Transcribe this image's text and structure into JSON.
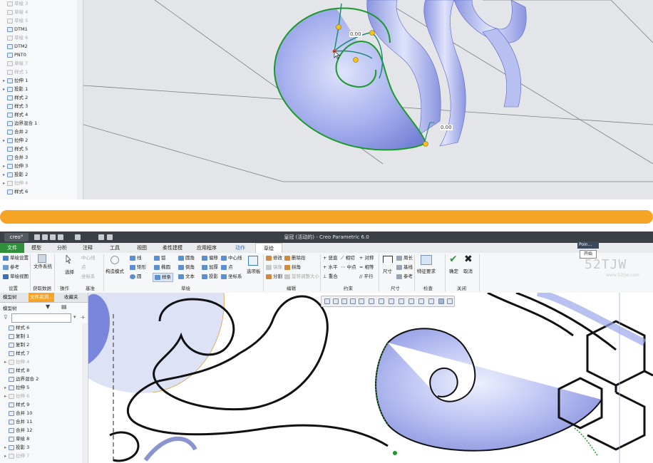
{
  "top_tree": {
    "rows": [
      {
        "label": "草绘 3",
        "icon": "sketch-icon",
        "dim": true
      },
      {
        "label": "草绘 4",
        "icon": "sketch-icon",
        "dim": true
      },
      {
        "label": "草绘 5",
        "icon": "sketch-icon",
        "dim": true
      },
      {
        "label": "DTM1",
        "icon": "datum-plane-icon",
        "dim": false
      },
      {
        "label": "草绘 6",
        "icon": "sketch-icon",
        "dim": true
      },
      {
        "label": "DTM2",
        "icon": "datum-plane-icon",
        "dim": false
      },
      {
        "label": "PNT0",
        "icon": "datum-point-icon",
        "dim": false
      },
      {
        "label": "草绘 7",
        "icon": "sketch-icon",
        "dim": true
      },
      {
        "label": "样式 1",
        "icon": "style-icon",
        "dim": true
      },
      {
        "label": "拉伸 1",
        "icon": "extrude-icon",
        "dim": false
      },
      {
        "label": "投影 1",
        "icon": "project-icon",
        "dim": false
      },
      {
        "label": "样式 2",
        "icon": "style-icon",
        "dim": false
      },
      {
        "label": "样式 3",
        "icon": "style-icon",
        "dim": false
      },
      {
        "label": "样式 4",
        "icon": "style-icon",
        "dim": false
      },
      {
        "label": "边界混合 1",
        "icon": "boundary-blend-icon",
        "dim": false
      },
      {
        "label": "合并 2",
        "icon": "merge-icon",
        "dim": false
      },
      {
        "label": "拉伸 2",
        "icon": "extrude-icon",
        "dim": false
      },
      {
        "label": "样式 5",
        "icon": "style-icon",
        "dim": false
      },
      {
        "label": "合并 3",
        "icon": "merge-icon",
        "dim": false
      },
      {
        "label": "拉伸 3",
        "icon": "extrude-icon",
        "dim": false
      },
      {
        "label": "投影 2",
        "icon": "project-icon",
        "dim": false
      },
      {
        "label": "拉伸 4",
        "icon": "extrude-icon",
        "dim": true
      },
      {
        "label": "样式 6",
        "icon": "style-icon",
        "dim": false
      }
    ],
    "dim_labels": [
      "0.00",
      "0.00"
    ]
  },
  "app": {
    "logo": "creo°",
    "title": "皇冠 (活动的) - Creo Parametric 6.0"
  },
  "menubar": [
    "文件",
    "模型",
    "分析",
    "注释",
    "工具",
    "视图",
    "柔性建模",
    "应用程序",
    "动作",
    "草绘"
  ],
  "ribbon": {
    "setup": {
      "items": [
        "草绘设置",
        "参考",
        "草绘视图"
      ],
      "group": "设置"
    },
    "data": {
      "items": [
        "文件系统"
      ],
      "group": "获取数据"
    },
    "ops": {
      "items": [
        "选择",
        "中心线",
        "点",
        "坐标系"
      ],
      "group": "操作"
    },
    "datum": {
      "items": [
        "中心线",
        "点",
        "坐标系"
      ],
      "group": "基准"
    },
    "construct": {
      "items": [
        "构造模式"
      ]
    },
    "sketch": {
      "items": [
        "线",
        "弧",
        "圆角",
        "偏移",
        "矩形",
        "椭圆",
        "倒角",
        "加厚",
        "圆",
        "样条",
        "文本",
        "投影",
        "中心线",
        "点",
        "坐标系",
        "选项板"
      ],
      "group": "草绘"
    },
    "edit": {
      "items": [
        "修改",
        "删除段",
        "镜像",
        "拐角",
        "分割",
        "旋转调整大小"
      ],
      "group": "编辑"
    },
    "constraint": {
      "items": [
        "竖直",
        "相切",
        "对称",
        "水平",
        "中点",
        "相等",
        "重合",
        "平行"
      ],
      "group": "约束"
    },
    "dimension": {
      "items": [
        "尺寸",
        "周长",
        "基线",
        "参考"
      ],
      "group": "尺寸"
    },
    "inspect": {
      "items": [
        "特征要求"
      ],
      "group": "检查"
    },
    "close": {
      "items": [
        "确定",
        "取消"
      ],
      "group": "关闭"
    }
  },
  "tree": {
    "tabs": [
      "模型树",
      "文件夹浏...",
      "收藏夹"
    ],
    "header": "模型树",
    "rows": [
      {
        "label": "样式 6",
        "icon": "style-icon",
        "dim": false
      },
      {
        "label": "复制 1",
        "icon": "copy-icon",
        "dim": false
      },
      {
        "label": "复制 2",
        "icon": "copy-icon",
        "dim": false
      },
      {
        "label": "样式 7",
        "icon": "style-icon",
        "dim": false
      },
      {
        "label": "拉伸 4",
        "icon": "extrude-icon",
        "dim": true
      },
      {
        "label": "样式 8",
        "icon": "style-icon",
        "dim": false
      },
      {
        "label": "边界混合 2",
        "icon": "boundary-blend-icon",
        "dim": false
      },
      {
        "label": "拉伸 5",
        "icon": "extrude-icon",
        "dim": false
      },
      {
        "label": "拉伸 6",
        "icon": "extrude-icon",
        "dim": true
      },
      {
        "label": "样式 9",
        "icon": "style-icon",
        "dim": false
      },
      {
        "label": "合并 10",
        "icon": "merge-icon",
        "dim": false
      },
      {
        "label": "合并 11",
        "icon": "merge-icon",
        "dim": false
      },
      {
        "label": "合并 12",
        "icon": "merge-icon",
        "dim": false
      },
      {
        "label": "草绘 8",
        "icon": "sketch-icon",
        "dim": false
      },
      {
        "label": "投影 3",
        "icon": "project-icon",
        "dim": false
      },
      {
        "label": "拉伸 7",
        "icon": "extrude-icon",
        "dim": true
      }
    ]
  },
  "popup": {
    "title": "Poin...",
    "button": "开始"
  },
  "watermark": {
    "text": "52TJW",
    "sub": "www.52tjw.com"
  },
  "colors": {
    "divider": "#f5a425",
    "file_tab": "#2f8f3a",
    "sketch_green": "#1a9a2a",
    "surface": "#a9b3f0"
  }
}
